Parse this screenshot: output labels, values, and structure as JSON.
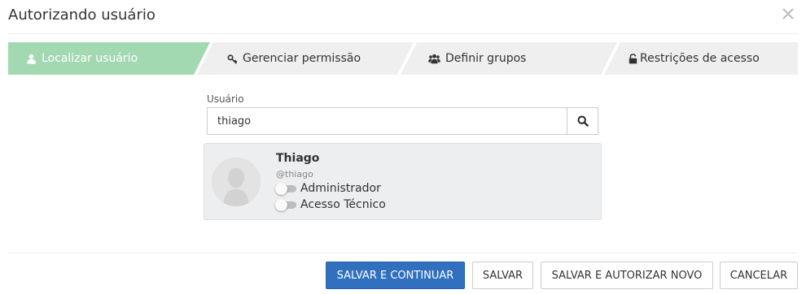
{
  "modal": {
    "title": "Autorizando usuário",
    "close_icon": "close-icon"
  },
  "steps": [
    {
      "label": "Localizar usuário",
      "icon": "user-icon",
      "active": true
    },
    {
      "label": "Gerenciar permissão",
      "icon": "key-icon",
      "active": false
    },
    {
      "label": "Definir grupos",
      "icon": "users-icon",
      "active": false
    },
    {
      "label": "Restrições de acesso",
      "icon": "unlock-icon",
      "active": false
    }
  ],
  "colors": {
    "active_step": "#a3d9b1",
    "inactive_step": "#efefef",
    "primary_button": "#3170bf"
  },
  "search": {
    "label": "Usuário",
    "value": "thiago",
    "icon": "search-icon"
  },
  "result": {
    "name": "Thiago",
    "handle": "@thiago",
    "avatar_icon": "avatar-placeholder-icon",
    "toggles": [
      {
        "label": "Administrador",
        "on": false
      },
      {
        "label": "Acesso Técnico",
        "on": false
      }
    ]
  },
  "footer": {
    "save_continue": "SALVAR E CONTINUAR",
    "save": "SALVAR",
    "save_authorize_new": "SALVAR E AUTORIZAR NOVO",
    "cancel": "CANCELAR"
  }
}
